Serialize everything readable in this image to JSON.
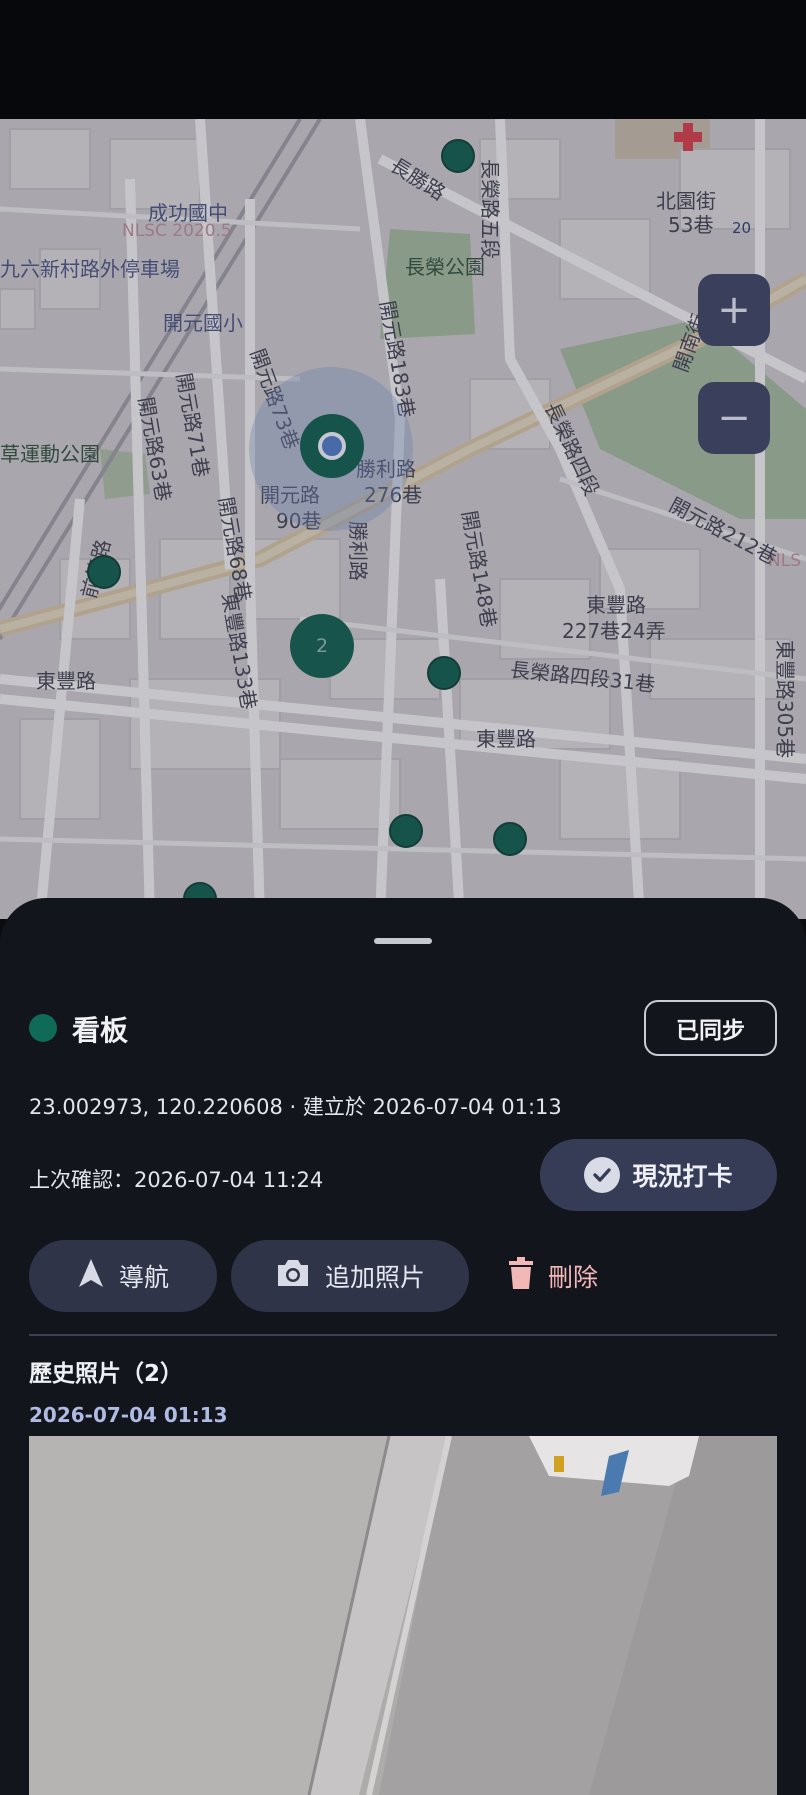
{
  "map": {
    "labels": {
      "chenggong": "成功國中",
      "parking": "九六新村路外停車場",
      "nlsc_left": "NLSC 2020.5",
      "nlsc_right": "NLS",
      "kaiyuan_school": "開元國小",
      "changrong_park": "長榮公園",
      "changsheng_rd": "長勝路",
      "changrong_rd5": "長榮路五段",
      "beiyuan_st": "北園街",
      "beiyuan_53": "53巷",
      "route_20": "20",
      "kainan_st": "開南街",
      "kaiyuan_183": "開元路183巷",
      "kaiyuan_73": "開元路73巷",
      "kaiyuan_71": "開元路71巷",
      "kaiyuan_63": "開元路63巷",
      "cao_sports_park": "草運動公園",
      "shengli_276_a": "勝利路",
      "shengli_276_b": "276巷",
      "kaiyuan_90_a": "開元路",
      "kaiyuan_90_b": "90巷",
      "kaiyuan_68": "開元路68巷",
      "shengli_rd": "勝利路",
      "qianfeng_rd": "前鋒路",
      "kaiyuan_148": "開元路148巷",
      "changrong_rd4": "長榮路四段",
      "kaiyuan_212": "開元路212巷",
      "dongfeng_227_a": "東豐路",
      "dongfeng_227_b": "227巷24弄",
      "dongfeng_133": "東豐路133巷",
      "changrong_31": "長榮路四段31巷",
      "dongfeng_rd": "東豐路",
      "dongfeng_305": "東豐路305巷",
      "dongfeng_rd2": "東豐路"
    },
    "cluster_count": "2",
    "zoom_in": "+",
    "zoom_out": "−"
  },
  "sheet": {
    "title": "看板",
    "sync_status": "已同步",
    "coords_line": "23.002973, 120.220608 · 建立於 2026-07-04 01:13",
    "last_check": "上次確認：2026-07-04 11:24",
    "checkin_label": "現況打卡",
    "nav_label": "導航",
    "add_photo_label": "追加照片",
    "delete_label": "刪除",
    "history_title": "歷史照片（2）",
    "photo_date": "2026-07-04 01:13"
  },
  "colors": {
    "accent_green": "#0f6a58",
    "delete_red": "#f2b8b8",
    "date_blue": "#aebbe2",
    "sheet_bg": "#13151c"
  },
  "icons": {
    "nav": "navigation-arrow-icon",
    "photo": "camera-icon",
    "delete": "trash-icon",
    "checkin": "check-circle-icon"
  }
}
